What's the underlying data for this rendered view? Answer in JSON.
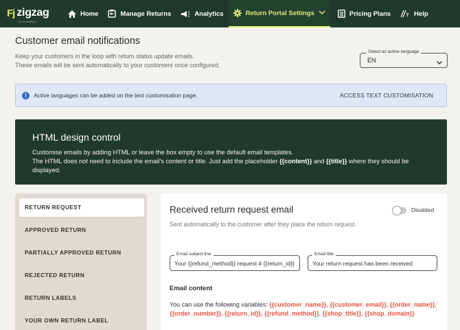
{
  "brand": {
    "mark": "Fj",
    "name": "zigzag",
    "sub": "by GlobalBlue"
  },
  "nav": {
    "items": [
      {
        "label": "Home",
        "icon": "home-icon"
      },
      {
        "label": "Manage Returns",
        "icon": "returns-icon"
      },
      {
        "label": "Analytics",
        "icon": "megaphone-icon"
      },
      {
        "label": "Return Portal Settings",
        "icon": "gear-icon",
        "active": true
      },
      {
        "label": "Pricing Plans",
        "icon": "list-icon"
      },
      {
        "label": "Help",
        "icon": "help-icon"
      }
    ]
  },
  "page": {
    "title": "Customer email notifications",
    "desc_line1": "Keep your customers in the loop with return status update emails.",
    "desc_line2": "These emails will be sent automatically to your customers once configured."
  },
  "language_select": {
    "legend": "Select an active language",
    "value": "EN"
  },
  "info_banner": {
    "text": "Active languages can be added on the text customisation page.",
    "link": "ACCESS TEXT CUSTOMISATION"
  },
  "design_control": {
    "title": "HTML design control",
    "line1": "Customise emails by adding HTML or leave the box empty to use the default email templates.",
    "line2_pre": "The HTML does not need to include the email's content or title. Just add the placeholder ",
    "placeholder_content": "{{content}}",
    "line2_mid": " and ",
    "placeholder_title": "{{title}}",
    "line2_post": " where they should be displayed."
  },
  "sidebar": {
    "items": [
      {
        "label": "RETURN REQUEST",
        "active": true
      },
      {
        "label": "APPROVED RETURN"
      },
      {
        "label": "PARTIALLY APPROVED RETURN"
      },
      {
        "label": "REJECTED RETURN"
      },
      {
        "label": "RETURN LABELS"
      },
      {
        "label": "YOUR OWN RETURN LABEL"
      }
    ]
  },
  "email": {
    "title": "Received return request email",
    "toggle_label": "Disabled",
    "enabled": false,
    "desc": "Sent automatically to the customer after they place the return request.",
    "subject_legend": "Email subject line",
    "subject_value": "Your {{refund_method}} request # {{return_id}}",
    "title_legend": "Email title",
    "title_value": "Your return request has been received",
    "content_heading": "Email content",
    "vars_intro": "You can use the following variables: ",
    "variables": [
      "{{customer_name}}",
      "{{customer_email}}",
      "{{order_name}}",
      "{{order_number}}",
      "{{return_id}}",
      "{{refund_method}}",
      "{{shop_title}}",
      "{{shop_domain}}"
    ]
  },
  "colors": {
    "nav_bg": "#1f3a2c",
    "nav_active": "#dfe87a",
    "info_bg": "#dfe7f7",
    "variable": "#e5533d",
    "page_bg": "#f3f2ef"
  }
}
